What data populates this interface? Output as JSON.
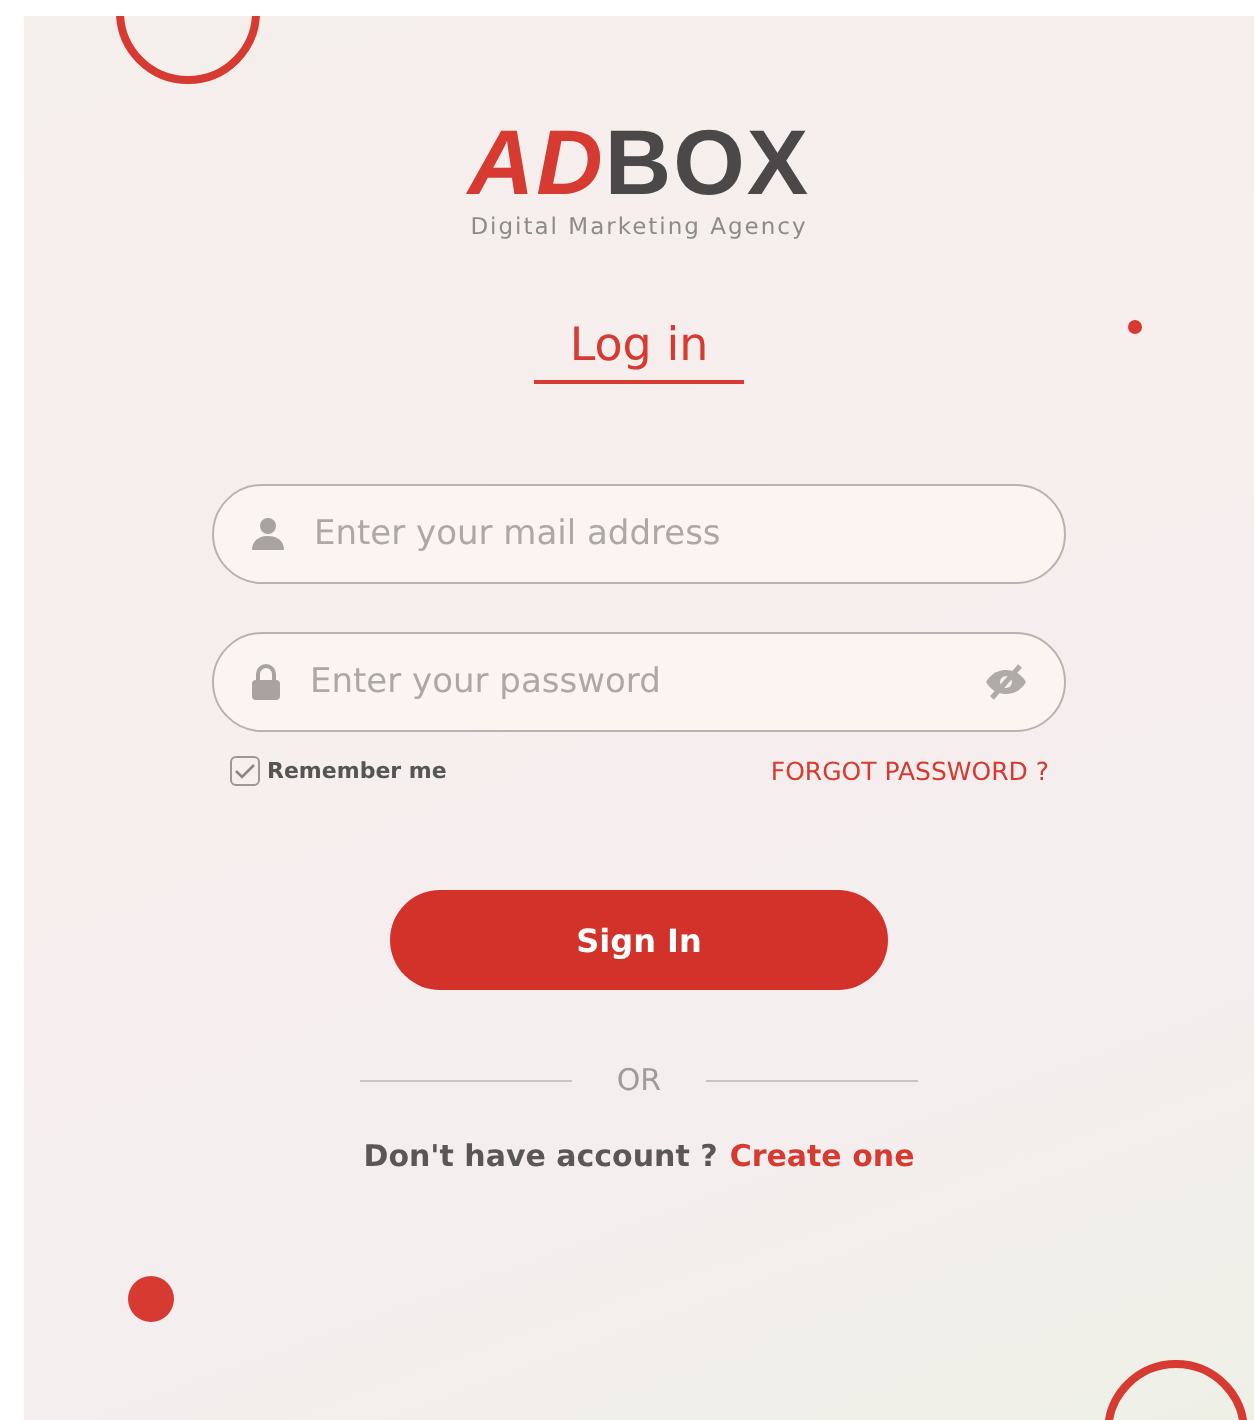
{
  "logo": {
    "mark": "AD",
    "name": "BOX",
    "tagline": "Digital Marketing Agency"
  },
  "heading": "Log in",
  "email_field": {
    "placeholder": "Enter your mail address"
  },
  "password_field": {
    "placeholder": "Enter your password"
  },
  "remember_me": {
    "label": "Remember me",
    "checked": true
  },
  "forgot_password": "FORGOT PASSWORD ?",
  "sign_in_button": "Sign In",
  "divider": "OR",
  "signup_prompt": {
    "text": "Don't have account ?",
    "link": "Create one"
  }
}
